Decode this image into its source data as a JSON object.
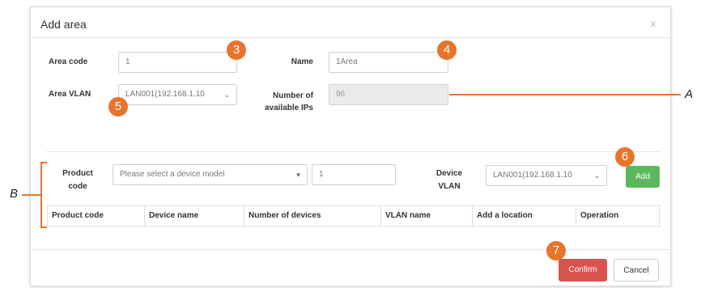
{
  "dialog": {
    "title": "Add area",
    "close": "x"
  },
  "form": {
    "area_code_label": "Area code",
    "area_code_value": "1",
    "name_label": "Name",
    "name_value": "1Area",
    "area_vlan_label": "Area VLAN",
    "area_vlan_value": "LAN001(192.168.1.10",
    "available_ips_label": "Number of available IPs",
    "available_ips_value": "96"
  },
  "device_row": {
    "product_code_label": "Product code",
    "product_placeholder": "Please select a device model",
    "quantity_value": "1",
    "device_vlan_label": "Device VLAN",
    "device_vlan_value": "LAN001(192.168.1.10",
    "add_button": "Add"
  },
  "table": {
    "columns": [
      "Product code",
      "Device name",
      "Number of devices",
      "VLAN name",
      "Add a location",
      "Operation"
    ]
  },
  "footer": {
    "confirm": "Confirm",
    "cancel": "Cancel"
  },
  "callouts": {
    "badges": [
      "3",
      "4",
      "5",
      "6",
      "7"
    ],
    "letters": [
      "A",
      "B"
    ]
  },
  "colors": {
    "callout_orange": "#e8732a",
    "add_green": "#5cb85c",
    "confirm_red": "#d9534f",
    "disabled_field": "#ebebeb"
  }
}
